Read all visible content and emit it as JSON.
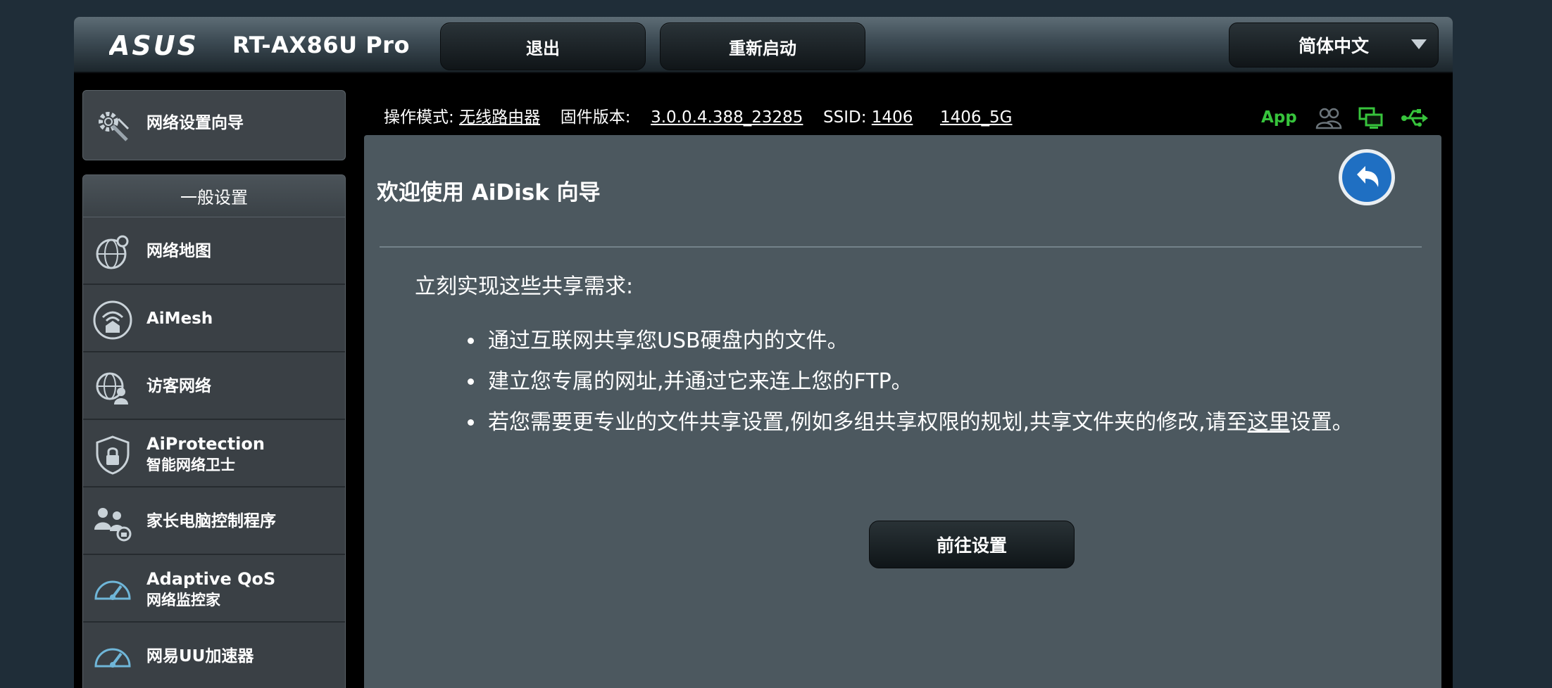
{
  "header": {
    "brand": "ASUS",
    "model": "RT-AX86U Pro",
    "logout_label": "退出",
    "reboot_label": "重新启动",
    "language": "简体中文"
  },
  "status": {
    "mode_label": "操作模式:",
    "mode_value": "无线路由器",
    "firmware_label": "固件版本:",
    "firmware_value": "3.0.0.4.388_23285",
    "ssid_label": "SSID:",
    "ssid_1": "1406",
    "ssid_2": "1406_5G",
    "app_label": "App",
    "icons": [
      "clients-icon",
      "network-icon",
      "usb-icon"
    ]
  },
  "sidebar": {
    "wizard_label": "网络设置向导",
    "group_title": "一般设置",
    "items": [
      {
        "label": "网络地图",
        "icon": "network-map-icon"
      },
      {
        "label": "AiMesh",
        "icon": "aimesh-icon"
      },
      {
        "label": "访客网络",
        "icon": "guest-network-icon"
      },
      {
        "label": "AiProtection",
        "sub": "智能网络卫士",
        "icon": "shield-icon"
      },
      {
        "label": "家长电脑控制程序",
        "icon": "parental-control-icon"
      },
      {
        "label": "Adaptive QoS",
        "sub": "网络监控家",
        "icon": "speedometer-icon"
      },
      {
        "label": "网易UU加速器",
        "icon": "speedometer-icon"
      }
    ]
  },
  "main": {
    "title": "欢迎使用 AiDisk 向导",
    "intro": "立刻实现这些共享需求:",
    "bullet_1": "通过互联网共享您USB硬盘内的文件。",
    "bullet_2": "建立您专属的网址,并通过它来连上您的FTP。",
    "bullet_3_prefix": "若您需要更专业的文件共享设置,例如多组共享权限的规划,共享文件夹的修改,请至",
    "bullet_3_link": "这里",
    "bullet_3_suffix": "设置。",
    "go_label": "前往设置"
  },
  "colors": {
    "accent_green": "#37c43c",
    "panel": "#4c585f",
    "sidebar": "#3a4045"
  }
}
